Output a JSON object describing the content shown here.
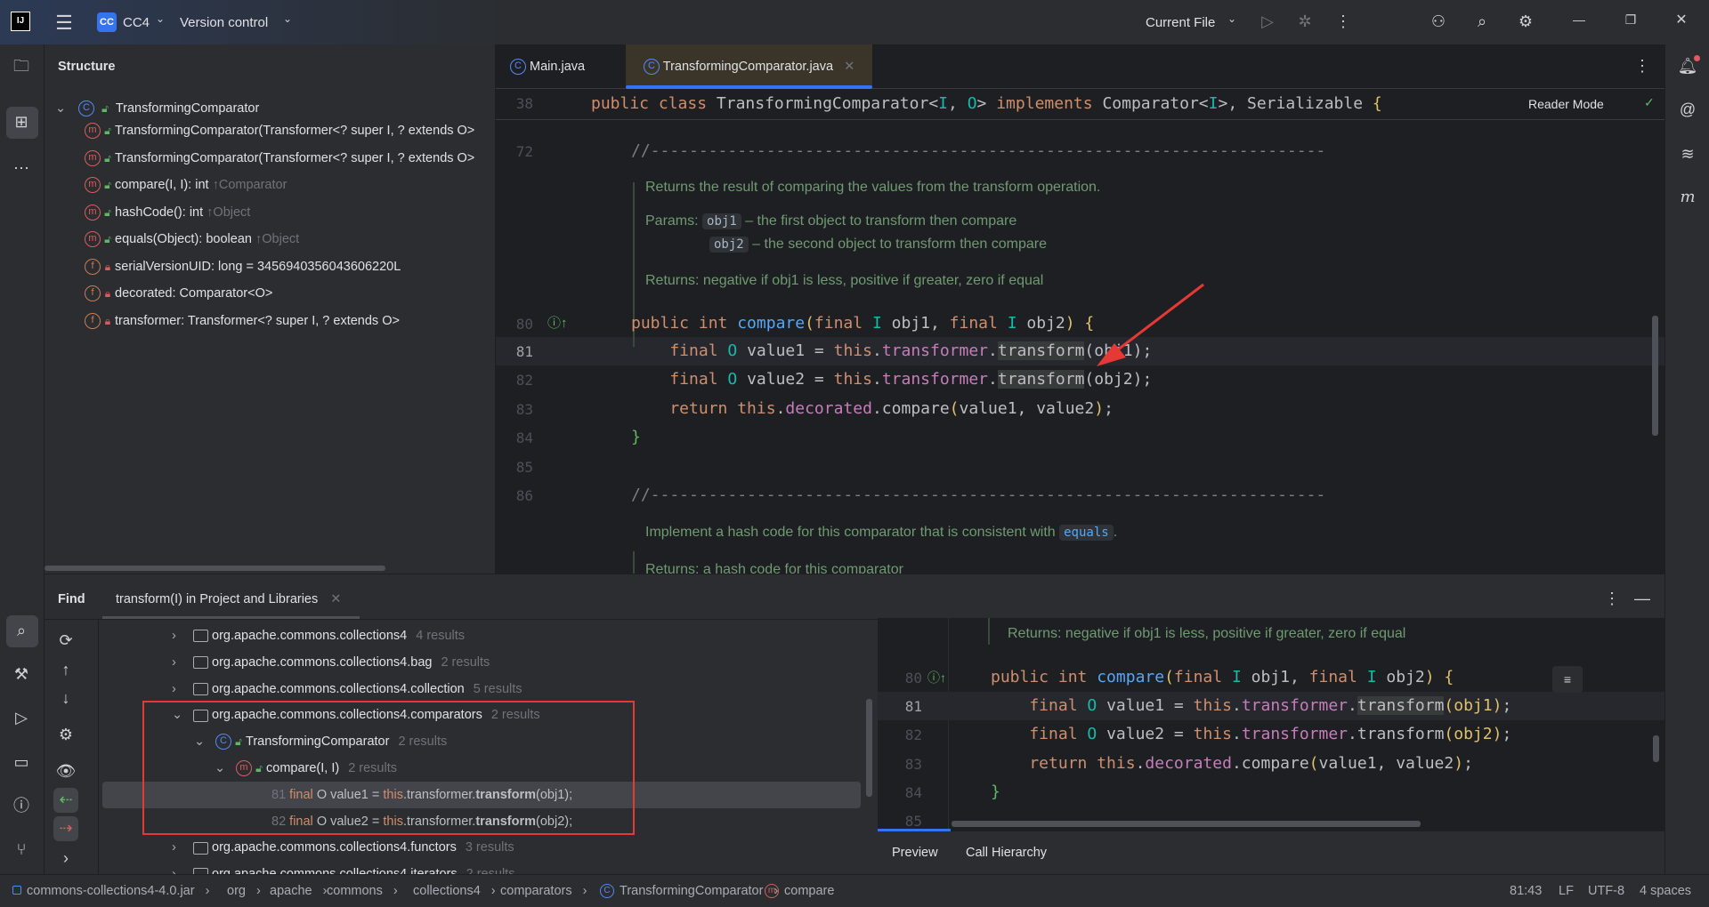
{
  "titlebar": {
    "app_logo": "IJ",
    "project_badge": "CC",
    "project": "CC4",
    "vcs": "Version control",
    "run_config": "Current File",
    "icons": [
      "hamburger-menu-icon",
      "chevron-down-icon",
      "run-icon",
      "debug-icon",
      "more-icon",
      "add-user-icon",
      "search-icon",
      "settings-icon",
      "minimize-icon",
      "restore-icon",
      "close-icon"
    ]
  },
  "structure": {
    "title": "Structure",
    "root": "TransformingComparator",
    "items": [
      {
        "icon": "method",
        "access": "public",
        "text": "TransformingComparator(Transformer<? super I, ? extends O>",
        "hint": ""
      },
      {
        "icon": "method",
        "access": "public",
        "text": "TransformingComparator(Transformer<? super I, ? extends O>",
        "hint": ""
      },
      {
        "icon": "method",
        "access": "public",
        "text": "compare(I, I): int ",
        "hint": "↑Comparator"
      },
      {
        "icon": "method",
        "access": "public",
        "text": "hashCode(): int ",
        "hint": "↑Object"
      },
      {
        "icon": "method",
        "access": "public",
        "text": "equals(Object): boolean ",
        "hint": "↑Object"
      },
      {
        "icon": "field",
        "access": "private",
        "text": "serialVersionUID: long = 3456940356043606220L",
        "hint": ""
      },
      {
        "icon": "field",
        "access": "private",
        "text": "decorated: Comparator<O>",
        "hint": ""
      },
      {
        "icon": "field",
        "access": "private",
        "text": "transformer: Transformer<? super I, ? extends O>",
        "hint": ""
      }
    ]
  },
  "editor": {
    "tabs": [
      {
        "label": "Main.java",
        "active": false
      },
      {
        "label": "TransformingComparator.java",
        "active": true
      }
    ],
    "reader_mode": "Reader Mode",
    "sticky": {
      "num": "38",
      "tokens": [
        [
          "public class ",
          "k"
        ],
        [
          "TransformingComparator",
          "p"
        ],
        [
          "<",
          "p"
        ],
        [
          "I",
          "t"
        ],
        [
          ", ",
          "p"
        ],
        [
          "O",
          "t"
        ],
        [
          "> ",
          "p"
        ],
        [
          "implements ",
          "k"
        ],
        [
          "Comparator<",
          "p"
        ],
        [
          "I",
          "t"
        ],
        [
          ">, Serializable ",
          "p"
        ],
        [
          "{",
          "b"
        ]
      ]
    },
    "lines": [
      {
        "num": "72",
        "tokens": [
          [
            "//----------------------------------------------------------------------",
            "c"
          ]
        ]
      },
      {
        "num": "80",
        "tokens": [
          [
            "public int ",
            "k"
          ],
          [
            "compare",
            "m"
          ],
          [
            "(",
            "b"
          ],
          [
            "final ",
            "k"
          ],
          [
            "I ",
            "t"
          ],
          [
            "obj1, ",
            "p"
          ],
          [
            "final ",
            "k"
          ],
          [
            "I ",
            "t"
          ],
          [
            "obj2",
            "p"
          ],
          [
            ") {",
            "b"
          ]
        ]
      },
      {
        "num": "81",
        "tokens": [
          [
            "    final ",
            "k"
          ],
          [
            "O ",
            "t"
          ],
          [
            "value1 = ",
            "p"
          ],
          [
            "this",
            "k"
          ],
          [
            ".",
            "p"
          ],
          [
            "transformer",
            "f"
          ],
          [
            ".",
            "p"
          ],
          [
            "transform",
            "p u"
          ],
          [
            "(obj1);",
            "p"
          ]
        ]
      },
      {
        "num": "82",
        "tokens": [
          [
            "    final ",
            "k"
          ],
          [
            "O ",
            "t"
          ],
          [
            "value2 = ",
            "p"
          ],
          [
            "this",
            "k"
          ],
          [
            ".",
            "p"
          ],
          [
            "transformer",
            "f"
          ],
          [
            ".",
            "p"
          ],
          [
            "transform",
            "p u"
          ],
          [
            "(obj2);",
            "p"
          ]
        ]
      },
      {
        "num": "83",
        "tokens": [
          [
            "    return ",
            "k"
          ],
          [
            "this",
            "k"
          ],
          [
            ".",
            "p"
          ],
          [
            "decorated",
            "f"
          ],
          [
            ".compare",
            "p"
          ],
          [
            "(",
            "b"
          ],
          [
            "value1, value2",
            "p"
          ],
          [
            ")",
            "b"
          ],
          [
            ";",
            "p"
          ]
        ]
      },
      {
        "num": "84",
        "tokens": [
          [
            "}",
            "g"
          ]
        ]
      },
      {
        "num": "85",
        "tokens": []
      },
      {
        "num": "86",
        "tokens": [
          [
            "//----------------------------------------------------------------------",
            "c"
          ]
        ]
      }
    ],
    "doc1": {
      "summary": "Returns the result of comparing the values from the transform operation.",
      "params_label": "Params:",
      "params": [
        {
          "name": "obj1",
          "desc": "– the first object to transform then compare"
        },
        {
          "name": "obj2",
          "desc": "– the second object to transform then compare"
        }
      ],
      "returns": "Returns: negative if obj1 is less, positive if greater, zero if equal"
    },
    "doc2": {
      "summary": "Implement a hash code for this comparator that is consistent with ",
      "link": "equals",
      "tail": ".",
      "returns": "Returns: a hash code for this comparator"
    }
  },
  "find": {
    "title": "Find",
    "tab": "transform(I) in Project and Libraries",
    "tree": [
      {
        "level": 0,
        "kind": "package",
        "expanded": false,
        "label": "org.apache.commons.collections4",
        "count": "4 results"
      },
      {
        "level": 0,
        "kind": "package",
        "expanded": false,
        "label": "org.apache.commons.collections4.bag",
        "count": "2 results"
      },
      {
        "level": 0,
        "kind": "package",
        "expanded": false,
        "label": "org.apache.commons.collections4.collection",
        "count": "5 results"
      },
      {
        "level": 0,
        "kind": "package",
        "expanded": true,
        "label": "org.apache.commons.collections4.comparators",
        "count": "2 results"
      },
      {
        "level": 1,
        "kind": "class",
        "expanded": true,
        "label": "TransformingComparator",
        "count": "2 results"
      },
      {
        "level": 2,
        "kind": "method",
        "expanded": true,
        "label": "compare(I, I)",
        "count": "2 results"
      },
      {
        "level": 3,
        "kind": "usage",
        "selected": true,
        "tokens": [
          [
            "81 ",
            "n"
          ],
          [
            "final ",
            "k"
          ],
          [
            "O value1 = ",
            "p"
          ],
          [
            "this",
            "k"
          ],
          [
            ".transformer.",
            "p"
          ],
          [
            "transform",
            "p bo"
          ],
          [
            "(obj1);",
            "p"
          ]
        ]
      },
      {
        "level": 3,
        "kind": "usage",
        "selected": false,
        "tokens": [
          [
            "82 ",
            "n"
          ],
          [
            "final ",
            "k"
          ],
          [
            "O value2 = ",
            "p"
          ],
          [
            "this",
            "k"
          ],
          [
            ".transformer.",
            "p"
          ],
          [
            "transform",
            "p bo"
          ],
          [
            "(obj2);",
            "p"
          ]
        ]
      },
      {
        "level": 0,
        "kind": "package",
        "expanded": false,
        "label": "org.apache.commons.collections4.functors",
        "count": "3 results"
      },
      {
        "level": 0,
        "kind": "package",
        "expanded": false,
        "label": "org.apache.commons.collections4.iterators",
        "count": "2 results"
      }
    ],
    "preview": {
      "doc_returns": "Returns: negative if obj1 is less, positive if greater, zero if equal",
      "lines": [
        {
          "num": "80",
          "tokens": [
            [
              "public int ",
              "k"
            ],
            [
              "compare",
              "m"
            ],
            [
              "(",
              "b"
            ],
            [
              "final ",
              "k"
            ],
            [
              "I ",
              "t"
            ],
            [
              "obj1, ",
              "p"
            ],
            [
              "final ",
              "k"
            ],
            [
              "I ",
              "t"
            ],
            [
              "obj2",
              "p"
            ],
            [
              ") {",
              "b"
            ]
          ]
        },
        {
          "num": "81",
          "tokens": [
            [
              "    final ",
              "k"
            ],
            [
              "O ",
              "t"
            ],
            [
              "value1 = ",
              "p"
            ],
            [
              "this",
              "k"
            ],
            [
              ".",
              "p"
            ],
            [
              "transformer",
              "f"
            ],
            [
              ".",
              "p"
            ],
            [
              "transform",
              "p u"
            ],
            [
              "(obj1)",
              "b"
            ],
            [
              ";",
              "p"
            ]
          ]
        },
        {
          "num": "82",
          "tokens": [
            [
              "    final ",
              "k"
            ],
            [
              "O ",
              "t"
            ],
            [
              "value2 = ",
              "p"
            ],
            [
              "this",
              "k"
            ],
            [
              ".",
              "p"
            ],
            [
              "transformer",
              "f"
            ],
            [
              ".",
              "p"
            ],
            [
              "transform",
              "p"
            ],
            [
              "(obj2)",
              "b"
            ],
            [
              ";",
              "p"
            ]
          ]
        },
        {
          "num": "83",
          "tokens": [
            [
              "    return ",
              "k"
            ],
            [
              "this",
              "k"
            ],
            [
              ".",
              "p"
            ],
            [
              "decorated",
              "f"
            ],
            [
              ".compare",
              "p"
            ],
            [
              "(",
              "b"
            ],
            [
              "value1, value2",
              "p"
            ],
            [
              ")",
              "b"
            ],
            [
              ";",
              "p"
            ]
          ]
        },
        {
          "num": "84",
          "tokens": [
            [
              "}",
              "g"
            ]
          ]
        },
        {
          "num": "85",
          "tokens": []
        }
      ],
      "tabs": [
        "Preview",
        "Call Hierarchy"
      ]
    }
  },
  "statusbar": {
    "breadcrumb": [
      "commons-collections4-4.0.jar",
      "org",
      "apache",
      "commons",
      "collections4",
      "comparators",
      "TransformingComparator",
      "compare"
    ],
    "position": "81:43",
    "line_sep": "LF",
    "encoding": "UTF-8",
    "indent": "4 spaces"
  },
  "colors": {
    "accent": "#3574f0",
    "keyword": "#cf8e6d",
    "method": "#56a8f5",
    "field": "#c77dbb",
    "type_param": "#16baac",
    "highlight_box": "#e53935"
  }
}
